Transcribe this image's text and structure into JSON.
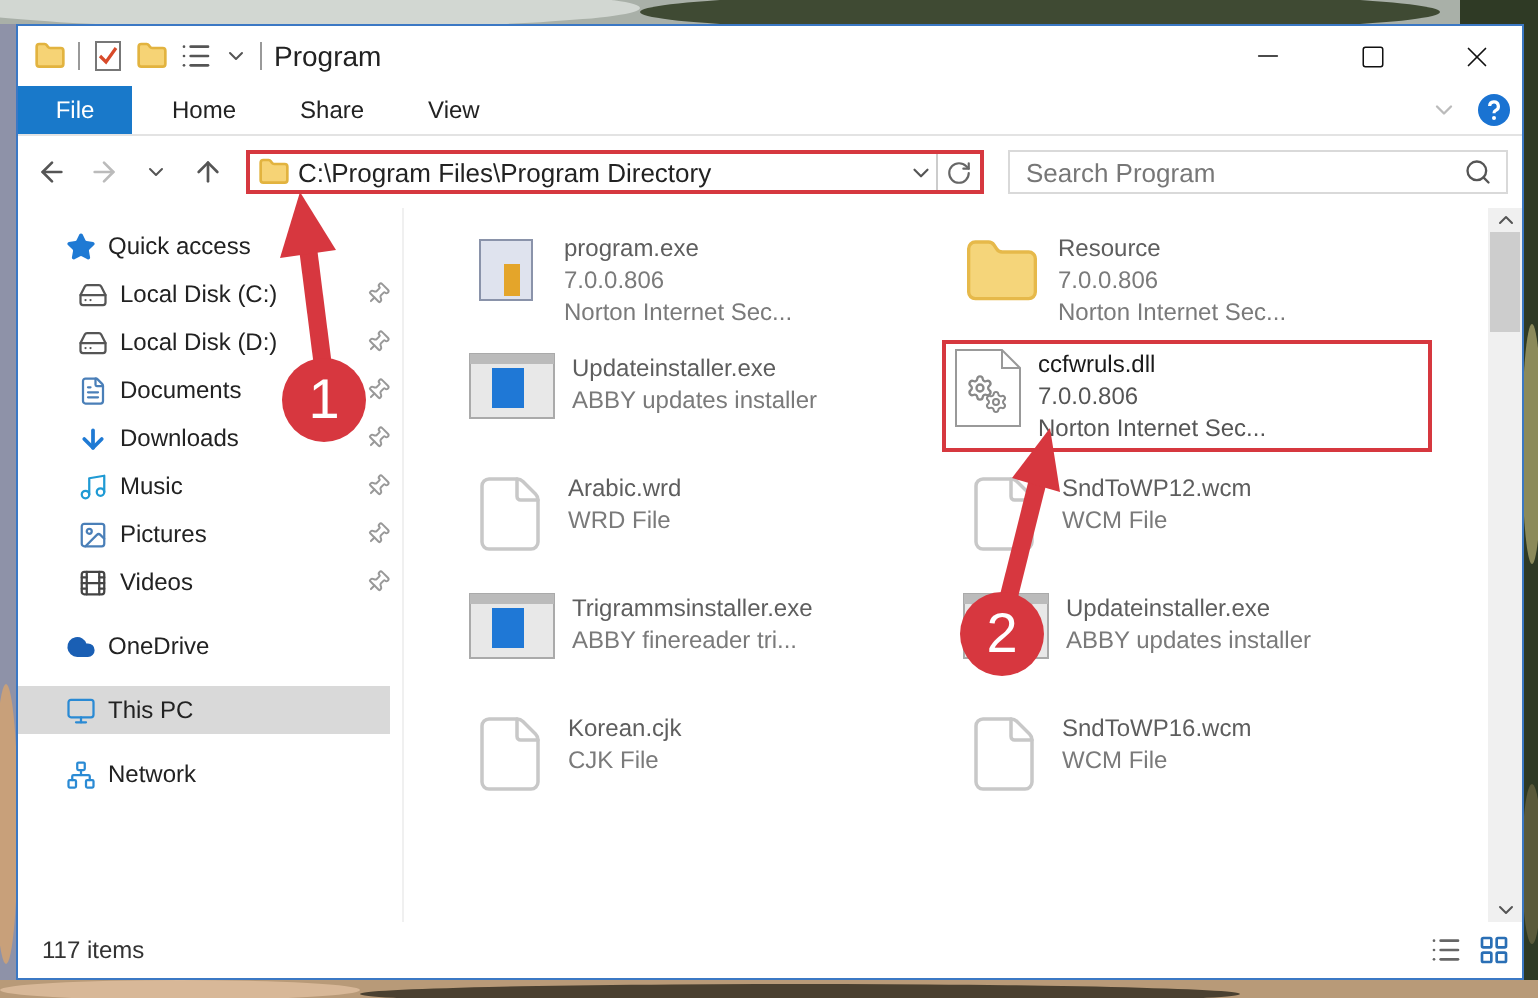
{
  "window": {
    "title": "Program"
  },
  "ribbon": {
    "tabs": [
      {
        "label": "File",
        "kind": "file"
      },
      {
        "label": "Home",
        "kind": "tab"
      },
      {
        "label": "Share",
        "kind": "tab"
      },
      {
        "label": "View",
        "kind": "tab"
      }
    ]
  },
  "address": {
    "path": "C:\\Program Files\\Program Directory",
    "highlighted": true
  },
  "search": {
    "placeholder": "Search Program"
  },
  "sidebar": {
    "items": [
      {
        "label": "Quick access",
        "kind": "star",
        "selected": false,
        "children": [
          {
            "label": "Local Disk (C:)",
            "kind": "system-drive",
            "pinned": true,
            "selected": false
          },
          {
            "label": "Local Disk (D:)",
            "kind": "drive",
            "pinned": true,
            "selected": false
          },
          {
            "label": "Documents",
            "kind": "documents",
            "pinned": true,
            "selected": false
          },
          {
            "label": "Downloads",
            "kind": "downloads",
            "pinned": true,
            "selected": false
          },
          {
            "label": "Music",
            "kind": "music",
            "pinned": true,
            "selected": false
          },
          {
            "label": "Pictures",
            "kind": "pictures",
            "pinned": true,
            "selected": false
          },
          {
            "label": "Videos",
            "kind": "videos",
            "pinned": true,
            "selected": false
          }
        ]
      },
      {
        "label": "OneDrive",
        "kind": "cloud",
        "selected": false
      },
      {
        "label": "This PC",
        "kind": "pc",
        "selected": true
      },
      {
        "label": "Network",
        "kind": "network",
        "selected": false
      }
    ]
  },
  "files": [
    {
      "name": "program.exe",
      "details": [
        "7.0.0.806",
        "Norton Internet Sec..."
      ],
      "kind": "program",
      "blurred": true,
      "highlighted": false
    },
    {
      "name": "Resource",
      "details": [
        "7.0.0.806",
        "Norton Internet Sec..."
      ],
      "kind": "folder",
      "blurred": true,
      "highlighted": false
    },
    {
      "name": "Updateinstaller.exe",
      "details": [
        "ABBY updates installer"
      ],
      "kind": "installer",
      "blurred": true,
      "highlighted": false
    },
    {
      "name": "ccfwruls.dll",
      "details": [
        "7.0.0.806",
        "Norton Internet Sec..."
      ],
      "kind": "dll",
      "blurred": false,
      "highlighted": true
    },
    {
      "name": "Arabic.wrd",
      "details": [
        "WRD File"
      ],
      "kind": "document",
      "blurred": true,
      "highlighted": false
    },
    {
      "name": "SndToWP12.wcm",
      "details": [
        "WCM File"
      ],
      "kind": "document",
      "blurred": true,
      "highlighted": false
    },
    {
      "name": "Trigrammsinstaller.exe",
      "details": [
        "ABBY finereader tri..."
      ],
      "kind": "installer",
      "blurred": true,
      "highlighted": false
    },
    {
      "name": "Updateinstaller.exe",
      "details": [
        "ABBY updates installer"
      ],
      "kind": "installer",
      "blurred": true,
      "highlighted": false
    },
    {
      "name": "Korean.cjk",
      "details": [
        "CJK File"
      ],
      "kind": "document",
      "blurred": true,
      "highlighted": false
    },
    {
      "name": "SndToWP16.wcm",
      "details": [
        "WCM File"
      ],
      "kind": "document",
      "blurred": true,
      "highlighted": false
    }
  ],
  "annotations": [
    {
      "number": "1"
    },
    {
      "number": "2"
    }
  ],
  "status_bar": {
    "count": "117 items"
  }
}
